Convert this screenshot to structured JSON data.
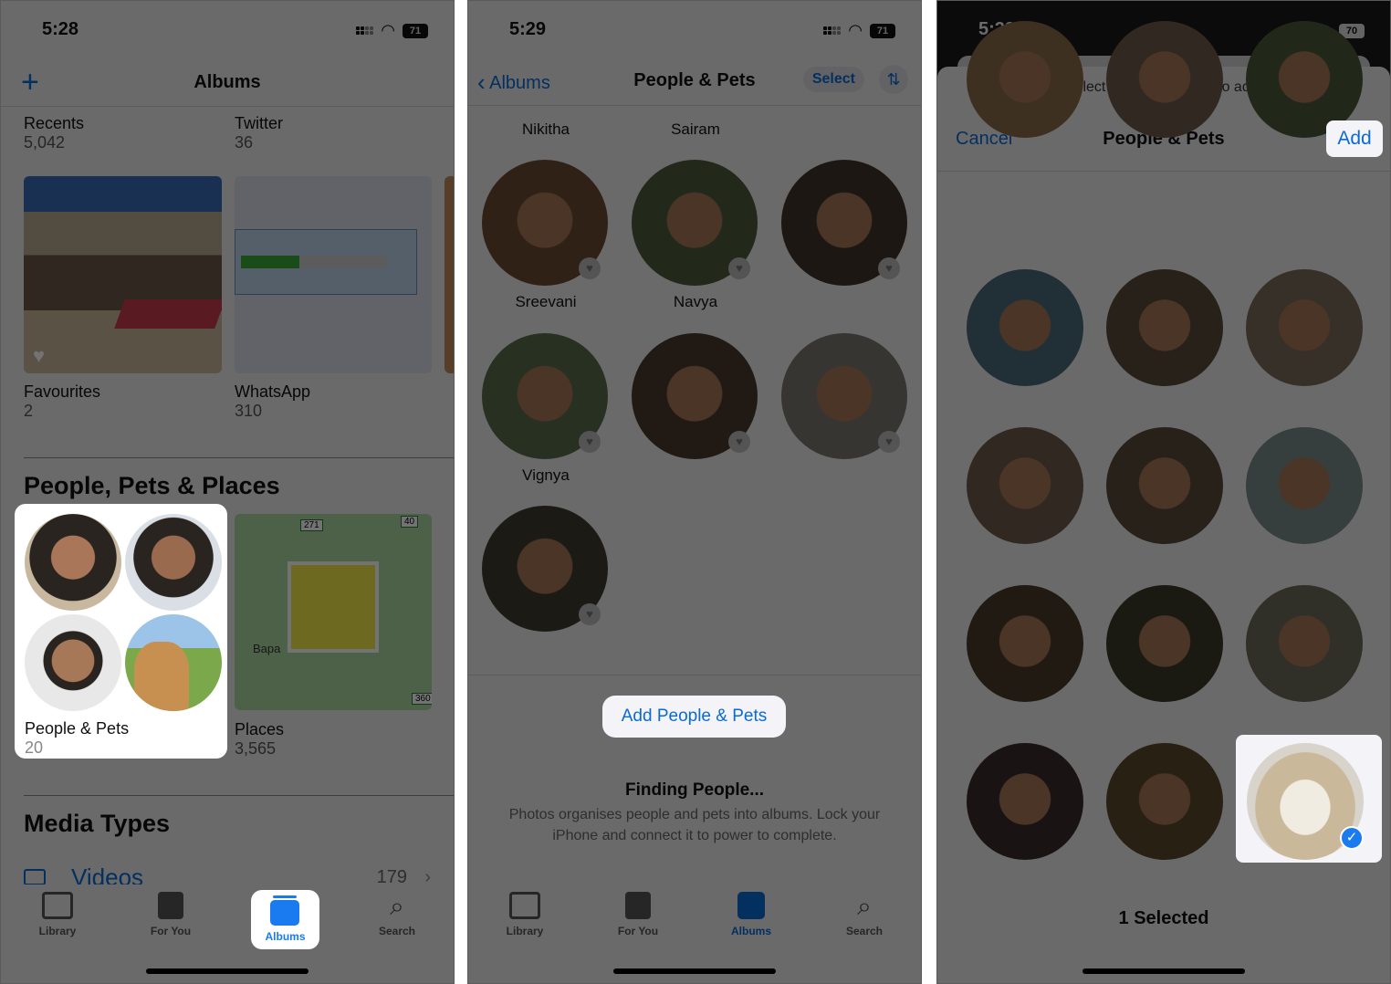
{
  "panel1": {
    "status": {
      "time": "5:28",
      "battery": "71"
    },
    "nav": {
      "title": "Albums",
      "add_icon": "plus-icon"
    },
    "albums_row1": [
      {
        "name": "Recents",
        "count": "5,042"
      },
      {
        "name": "Twitter",
        "count": "36"
      }
    ],
    "albums_row2": [
      {
        "name": "Favourites",
        "count": "2"
      },
      {
        "name": "WhatsApp",
        "count": "310"
      }
    ],
    "section_people": "People, Pets & Places",
    "people_album": {
      "name": "People & Pets",
      "count": "20"
    },
    "places_album": {
      "name": "Places",
      "count": "3,565",
      "map_label": "Bapa",
      "road_signs": [
        "271",
        "40",
        "360"
      ]
    },
    "section_media": "Media Types",
    "media_videos": {
      "label": "Videos",
      "count": "179"
    },
    "tabs": [
      {
        "label": "Library",
        "icon": "photo-library-icon"
      },
      {
        "label": "For You",
        "icon": "for-you-icon"
      },
      {
        "label": "Albums",
        "icon": "albums-icon",
        "active": true
      },
      {
        "label": "Search",
        "icon": "search-icon"
      }
    ]
  },
  "panel2": {
    "status": {
      "time": "5:29",
      "battery": "71"
    },
    "nav": {
      "back_label": "Albums",
      "title": "People & Pets",
      "select_label": "Select",
      "sort_icon": "sort-arrows-icon"
    },
    "top_names": [
      "Nikitha",
      "Sairam"
    ],
    "people": [
      {
        "name": "Sreevani",
        "tone": "#6b4a33"
      },
      {
        "name": "Navya",
        "tone": "#4d5b3a"
      },
      {
        "name": "",
        "tone": "#3e3428"
      },
      {
        "name": "Vignya",
        "tone": "#5a6b4a"
      },
      {
        "name": "",
        "tone": "#4a3a2e"
      },
      {
        "name": "",
        "tone": "#7a7670"
      },
      {
        "name": "",
        "tone": "#3f3a30"
      }
    ],
    "add_button": "Add People & Pets",
    "finding_title": "Finding People...",
    "finding_desc": "Photos organises people and pets into albums. Lock your iPhone and connect it to power to complete.",
    "tabs": [
      {
        "label": "Library"
      },
      {
        "label": "For You"
      },
      {
        "label": "Albums",
        "active": true
      },
      {
        "label": "Search"
      }
    ]
  },
  "panel3": {
    "status": {
      "time": "5:29",
      "battery": "70"
    },
    "sheet_prompt": "Select people and pets to add.",
    "nav": {
      "cancel_label": "Cancel",
      "title": "People & Pets",
      "add_label": "Add"
    },
    "people_tones": [
      "#8a6a4a",
      "#6a5a4a",
      "#4a5a3a",
      "#4a6a7a",
      "#5a4a3a",
      "#7a6a5a",
      "#6a5a4a",
      "#5a4a3a",
      "#7a8a8a",
      "#4a3a2a",
      "#3a3a2a",
      "#6a6a5a",
      "#3a2a2a",
      "#5a4a2a"
    ],
    "selected_item": {
      "type": "pet",
      "selected": true
    },
    "selected_count": "1 Selected"
  },
  "colors": {
    "accent": "#0a6ad6",
    "highlight": "#f3f3f8",
    "check": "#1a7af0"
  }
}
